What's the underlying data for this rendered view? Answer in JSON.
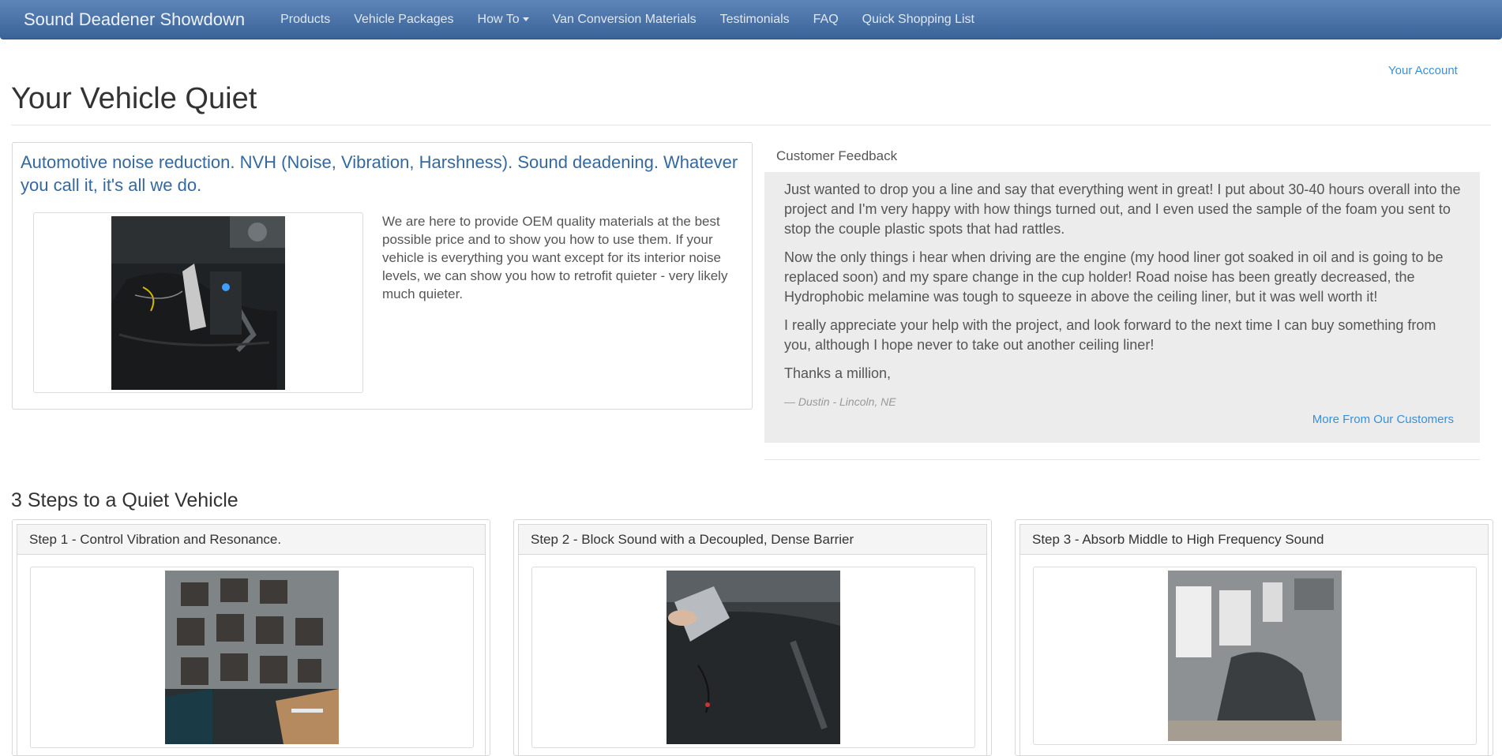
{
  "nav": {
    "brand": "Sound Deadener Showdown",
    "items": [
      "Products",
      "Vehicle Packages",
      "How To",
      "Van Conversion Materials",
      "Testimonials",
      "FAQ",
      "Quick Shopping List"
    ]
  },
  "account_link": "Your Account",
  "page_title": "Your Vehicle Quiet",
  "intro": {
    "heading": "Automotive noise reduction. NVH (Noise, Vibration, Harshness). Sound deadening. Whatever you call it, it's all we do.",
    "text": "We are here to provide OEM quality materials at the best possible price and to show you how to use them. If your vehicle is everything you want except for its interior noise levels, we can show you how to retrofit quieter - very likely much quieter."
  },
  "feedback": {
    "label": "Customer Feedback",
    "paragraphs": [
      "Just wanted to drop you a line and say that everything went in great! I put about 30-40 hours overall into the project and I'm very happy with how things turned out, and I even used the sample of the foam you sent to stop the couple plastic spots that had rattles.",
      "Now the only things i hear when driving are the engine (my hood liner got soaked in oil and is going to be replaced soon) and my spare change in the cup holder! Road noise has been greatly decreased, the Hydrophobic melamine was tough to squeeze in above the ceiling liner, but it was well worth it!",
      "I really appreciate your help with the project, and look forward to the next time I can buy something from you, although I hope never to take out another ceiling liner!",
      "Thanks a million,"
    ],
    "cite": "— Dustin - Lincoln, NE",
    "more_link": "More From Our Customers"
  },
  "steps": {
    "title": "3 Steps to a Quiet Vehicle",
    "items": [
      {
        "label": "Step 1 - Control Vibration and Resonance."
      },
      {
        "label": "Step 2 - Block Sound with a Decoupled, Dense Barrier"
      },
      {
        "label": "Step 3 - Absorb Middle to High Frequency Sound"
      }
    ]
  }
}
